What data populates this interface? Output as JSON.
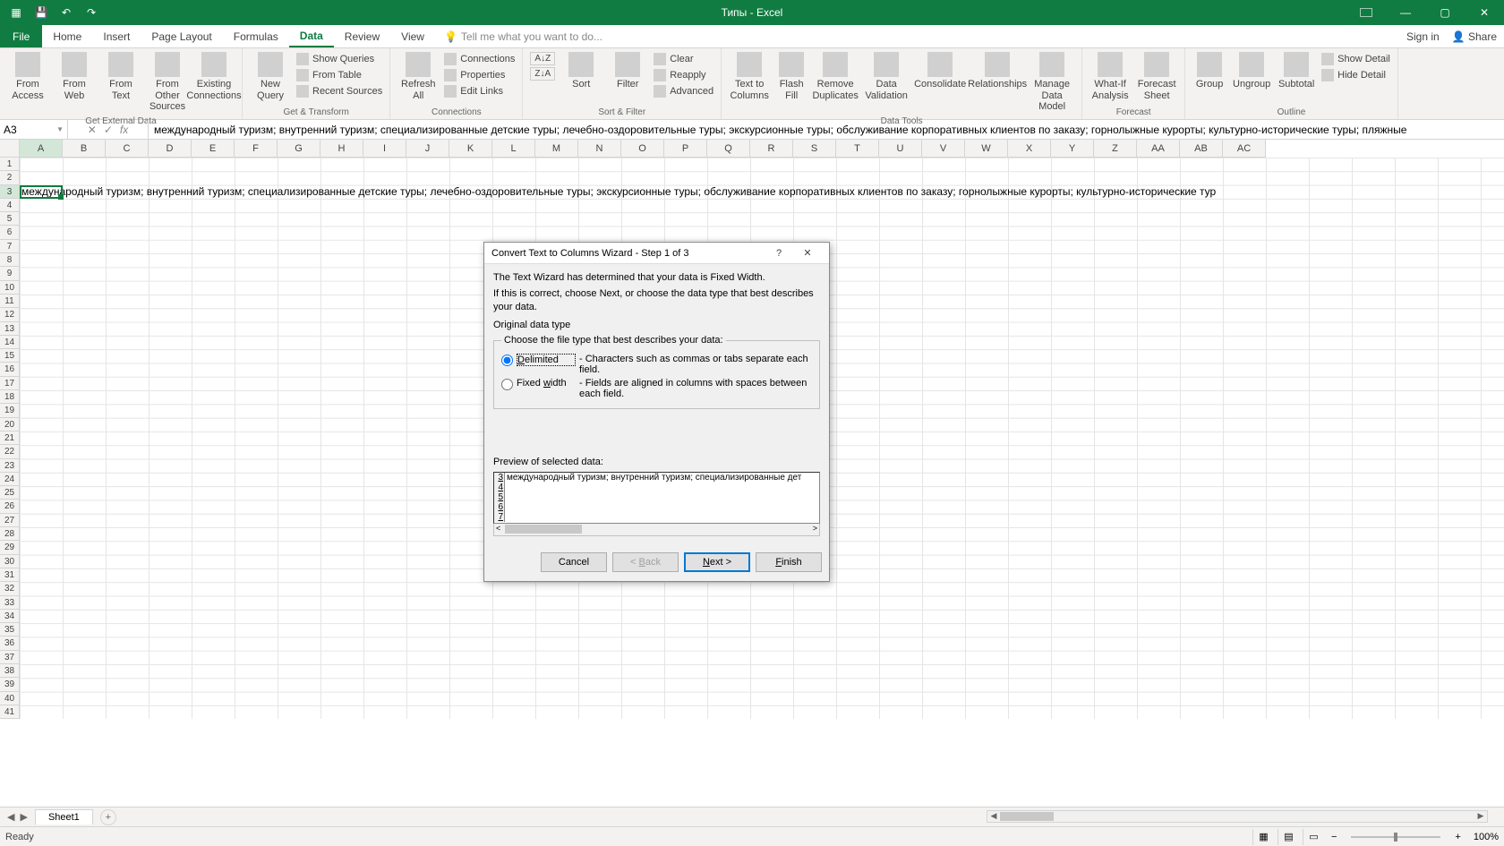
{
  "titlebar": {
    "title": "Типы - Excel"
  },
  "menutabs": {
    "file": "File",
    "tabs": [
      "Home",
      "Insert",
      "Page Layout",
      "Formulas",
      "Data",
      "Review",
      "View"
    ],
    "active_index": 4,
    "tell_me": "Tell me what you want to do...",
    "sign_in": "Sign in",
    "share": "Share"
  },
  "ribbon": {
    "groups": {
      "get_external": {
        "label": "Get External Data",
        "from_access": "From Access",
        "from_web": "From Web",
        "from_text": "From Text",
        "from_other": "From Other Sources",
        "existing": "Existing Connections"
      },
      "get_transform": {
        "label": "Get & Transform",
        "new_query": "New Query",
        "show_queries": "Show Queries",
        "from_table": "From Table",
        "recent": "Recent Sources"
      },
      "connections": {
        "label": "Connections",
        "refresh": "Refresh All",
        "conns": "Connections",
        "props": "Properties",
        "edit_links": "Edit Links"
      },
      "sort_filter": {
        "label": "Sort & Filter",
        "sort": "Sort",
        "filter": "Filter",
        "clear": "Clear",
        "reapply": "Reapply",
        "advanced": "Advanced"
      },
      "data_tools": {
        "label": "Data Tools",
        "text_to_cols": "Text to Columns",
        "flash_fill": "Flash Fill",
        "remove_dup": "Remove Duplicates",
        "validation": "Data Validation",
        "consolidate": "Consolidate",
        "relationships": "Relationships",
        "manage_model": "Manage Data Model"
      },
      "forecast": {
        "label": "Forecast",
        "whatif": "What-If Analysis",
        "forecast_sheet": "Forecast Sheet"
      },
      "outline": {
        "label": "Outline",
        "group": "Group",
        "ungroup": "Ungroup",
        "subtotal": "Subtotal",
        "show_detail": "Show Detail",
        "hide_detail": "Hide Detail"
      }
    }
  },
  "formula_bar": {
    "cell_ref": "A3",
    "formula": "международный туризм; внутренний туризм; специализированные детские туры; лечебно-оздоровительные туры; экскурсионные туры; обслуживание корпоративных клиентов по заказу; горнолыжные курорты; культурно-исторические туры; пляжные"
  },
  "columns": [
    "A",
    "B",
    "C",
    "D",
    "E",
    "F",
    "G",
    "H",
    "I",
    "J",
    "K",
    "L",
    "M",
    "N",
    "O",
    "P",
    "Q",
    "R",
    "S",
    "T",
    "U",
    "V",
    "W",
    "X",
    "Y",
    "Z",
    "AA",
    "AB",
    "AC"
  ],
  "cell_content": "международный туризм; внутренний туризм; специализированные детские туры; лечебно-оздоровительные туры; экскурсионные туры; обслуживание корпоративных клиентов по заказу; горнолыжные курорты; культурно-исторические тур",
  "sheet": {
    "name": "Sheet1"
  },
  "status": {
    "ready": "Ready",
    "zoom": "100%"
  },
  "dialog": {
    "title": "Convert Text to Columns Wizard - Step 1 of 3",
    "line1": "The Text Wizard has determined that your data is Fixed Width.",
    "line2": "If this is correct, choose Next, or choose the data type that best describes your data.",
    "original_data_type": "Original data type",
    "choose_file_type": "Choose the file type that best describes your data:",
    "delimited": "Delimited",
    "delimited_desc": "- Characters such as commas or tabs separate each field.",
    "fixed_width": "Fixed width",
    "fixed_width_desc": "- Fields are aligned in columns with spaces between each field.",
    "preview_label": "Preview of selected data:",
    "preview_rows": [
      3,
      4,
      5,
      6,
      7
    ],
    "preview_text": "международный туризм; внутренний туризм; специализированные дет",
    "cancel": "Cancel",
    "back": "< Back",
    "next": "Next >",
    "finish": "Finish"
  }
}
